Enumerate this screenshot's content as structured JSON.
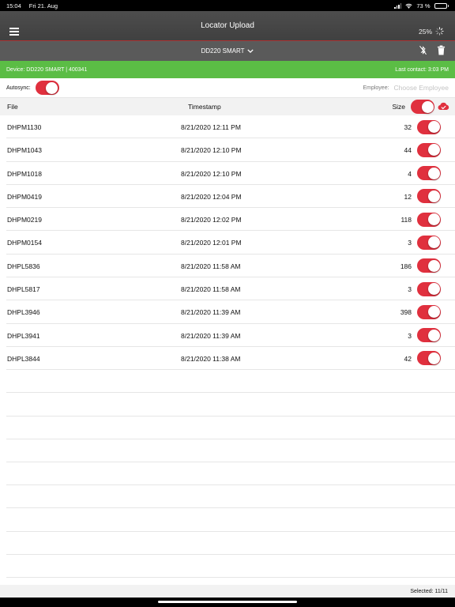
{
  "status_bar": {
    "time": "15:04",
    "date": "Fri 21. Aug",
    "battery": "73 %",
    "battery_level": 0.73
  },
  "header": {
    "title": "Locator Upload",
    "progress": "25%"
  },
  "subbar": {
    "device_name": "DD220 SMART"
  },
  "info": {
    "device": "Device: DD220 SMART | 400341",
    "last_contact": "Last contact: 3:03 PM"
  },
  "options": {
    "autosync_label": "Autosync:",
    "autosync_on": true,
    "employee_label": "Employee:",
    "employee_placeholder": "Choose Employee"
  },
  "table": {
    "columns": {
      "file": "File",
      "timestamp": "Timestamp",
      "size": "Size"
    },
    "rows": [
      {
        "file": "DHPM1130",
        "timestamp": "8/21/2020 12:11 PM",
        "size": "32",
        "selected": true
      },
      {
        "file": "DHPM1043",
        "timestamp": "8/21/2020 12:10 PM",
        "size": "44",
        "selected": true
      },
      {
        "file": "DHPM1018",
        "timestamp": "8/21/2020 12:10 PM",
        "size": "4",
        "selected": true
      },
      {
        "file": "DHPM0419",
        "timestamp": "8/21/2020 12:04 PM",
        "size": "12",
        "selected": true
      },
      {
        "file": "DHPM0219",
        "timestamp": "8/21/2020 12:02 PM",
        "size": "118",
        "selected": true
      },
      {
        "file": "DHPM0154",
        "timestamp": "8/21/2020 12:01 PM",
        "size": "3",
        "selected": true
      },
      {
        "file": "DHPL5836",
        "timestamp": "8/21/2020 11:58 AM",
        "size": "186",
        "selected": true
      },
      {
        "file": "DHPL5817",
        "timestamp": "8/21/2020 11:58 AM",
        "size": "3",
        "selected": true
      },
      {
        "file": "DHPL3946",
        "timestamp": "8/21/2020 11:39 AM",
        "size": "398",
        "selected": true
      },
      {
        "file": "DHPL3941",
        "timestamp": "8/21/2020 11:39 AM",
        "size": "3",
        "selected": true
      },
      {
        "file": "DHPL3844",
        "timestamp": "8/21/2020 11:38 AM",
        "size": "42",
        "selected": true
      }
    ]
  },
  "footer": {
    "selected": "Selected: 11/11"
  },
  "colors": {
    "accent_red": "#e0303e",
    "info_green": "#5bbd45",
    "header_gray": "#464646"
  },
  "icons": {
    "menu": "hamburger-icon",
    "spinner": "loading-spinner-icon",
    "bluetooth": "bluetooth-disabled-icon",
    "trash": "trash-icon",
    "cloud": "cloud-upload-check-icon"
  }
}
